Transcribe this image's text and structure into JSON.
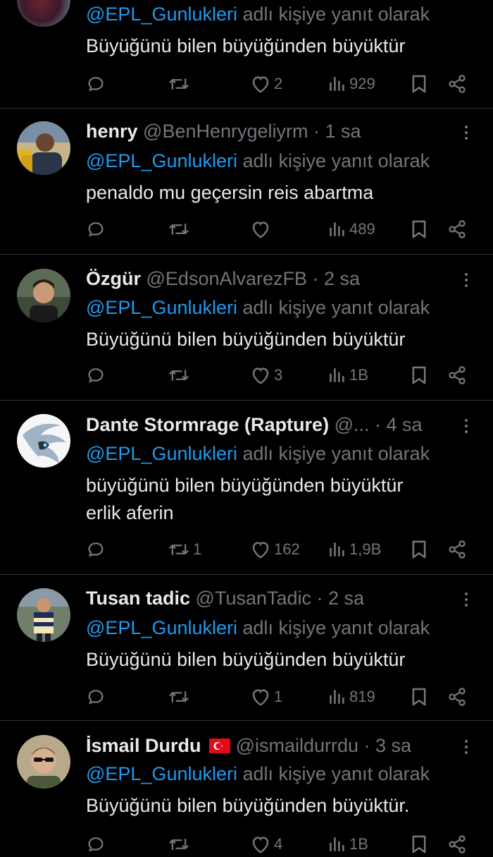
{
  "tweets": [
    {
      "name": "",
      "handle": "",
      "time": "",
      "reply_mention": "@EPL_Gunlukleri",
      "reply_rest": " adlı kişiye yanıt olarak",
      "body": [
        "Büyüğünü bilen büyüğünden büyüktür"
      ],
      "stats": {
        "replies": "",
        "reposts": "",
        "likes": "2",
        "views": "929"
      }
    },
    {
      "name": "henry",
      "handle": "@BenHenrygeliyrm",
      "time": "1 sa",
      "reply_mention": "@EPL_Gunlukleri",
      "reply_rest": " adlı kişiye yanıt olarak",
      "body": [
        "penaldo mu geçersin reis abartma"
      ],
      "stats": {
        "replies": "",
        "reposts": "",
        "likes": "",
        "views": "489"
      }
    },
    {
      "name": "Özgür",
      "handle": "@EdsonAlvarezFB",
      "time": "2 sa",
      "reply_mention": "@EPL_Gunlukleri",
      "reply_rest": " adlı kişiye yanıt olarak",
      "body": [
        "Büyüğünü bilen büyüğünden büyüktür"
      ],
      "stats": {
        "replies": "",
        "reposts": "",
        "likes": "3",
        "views": "1B"
      }
    },
    {
      "name": "Dante Stormrage (Rapture)",
      "handle": "@...",
      "time": "4 sa",
      "reply_mention": "@EPL_Gunlukleri",
      "reply_rest": " adlı kişiye yanıt olarak",
      "body": [
        "büyüğünü bilen büyüğünden büyüktür",
        "erlik aferin"
      ],
      "stats": {
        "replies": "",
        "reposts": "1",
        "likes": "162",
        "views": "1,9B"
      }
    },
    {
      "name": "Tusan tadic",
      "handle": "@TusanTadic",
      "time": "2 sa",
      "reply_mention": "@EPL_Gunlukleri",
      "reply_rest": " adlı kişiye yanıt olarak",
      "body": [
        "Büyüğünü bilen büyüğünden büyüktür"
      ],
      "stats": {
        "replies": "",
        "reposts": "",
        "likes": "1",
        "views": "819"
      }
    },
    {
      "name": "İsmail Durdu",
      "flag": "turkey-flag-icon",
      "handle": "@ismaildurrdu",
      "time": "3 sa",
      "reply_mention": "@EPL_Gunlukleri",
      "reply_rest": " adlı kişiye yanıt olarak",
      "body": [
        "Büyüğünü bilen büyüğünden büyüktür."
      ],
      "stats": {
        "replies": "",
        "reposts": "",
        "likes": "4",
        "views": "1B"
      }
    }
  ],
  "icons": {
    "reply": "reply-icon",
    "repost": "repost-icon",
    "like": "heart-icon",
    "views": "views-icon",
    "bookmark": "bookmark-icon",
    "share": "share-icon",
    "more": "more-options-icon"
  },
  "colors": {
    "background": "#000000",
    "text": "#e7e9ea",
    "secondary": "#71767b",
    "link": "#1d9bf0",
    "divider": "#2f3336"
  }
}
